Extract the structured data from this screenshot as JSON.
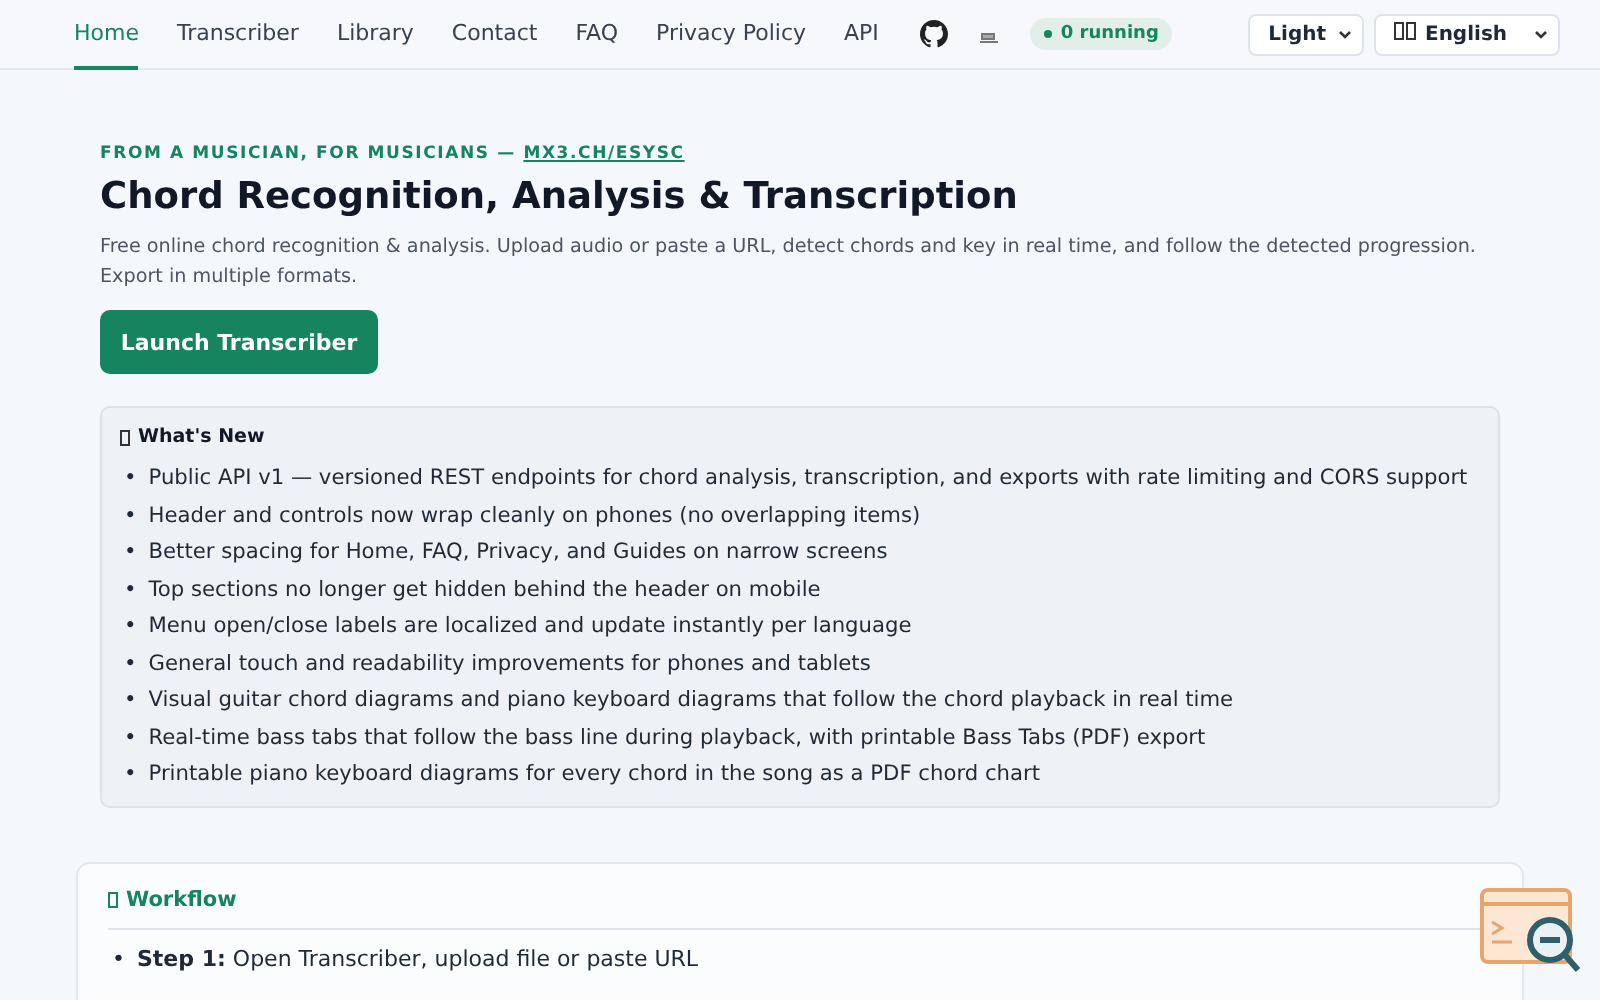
{
  "nav": {
    "links": [
      {
        "label": "Home",
        "selected": true
      },
      {
        "label": "Transcriber",
        "selected": false
      },
      {
        "label": "Library",
        "selected": false
      },
      {
        "label": "Contact",
        "selected": false
      },
      {
        "label": "FAQ",
        "selected": false
      },
      {
        "label": "Privacy Policy",
        "selected": false
      },
      {
        "label": "API",
        "selected": false
      }
    ],
    "status_badge": "0 running",
    "theme_select": "Light",
    "language_select": "English"
  },
  "hero": {
    "eyebrow": "FROM A MUSICIAN, FOR MUSICIANS —",
    "eyebrow_link": "MX3.CH/ESYSC",
    "title": "Chord Recognition, Analysis & Transcription",
    "description": "Free online chord recognition & analysis. Upload audio or paste a URL, detect chords and key in real time, and follow the detected progression. Export in multiple formats.",
    "button": "Launch Transcriber"
  },
  "whats_new": {
    "title": "What's New",
    "bullet": "•",
    "items": [
      "Public API v1 — versioned REST endpoints for chord analysis, transcription, and exports with rate limiting and CORS support",
      "Header and controls now wrap cleanly on phones (no overlapping items)",
      "Better spacing for Home, FAQ, Privacy, and Guides on narrow screens",
      "Top sections no longer get hidden behind the header on mobile",
      "Menu open/close labels are localized and update instantly per language",
      "General touch and readability improvements for phones and tablets",
      "Visual guitar chord diagrams and piano keyboard diagrams that follow the chord playback in real time",
      "Real-time bass tabs that follow the bass line during playback, with printable Bass Tabs (PDF) export",
      "Printable piano keyboard diagrams for every chord in the song as a PDF chord chart"
    ]
  },
  "workflow": {
    "title": "Workflow",
    "bullet": "•",
    "steps": [
      {
        "label": "Step 1:",
        "text": "Open Transcriber, upload file or paste URL"
      }
    ]
  }
}
